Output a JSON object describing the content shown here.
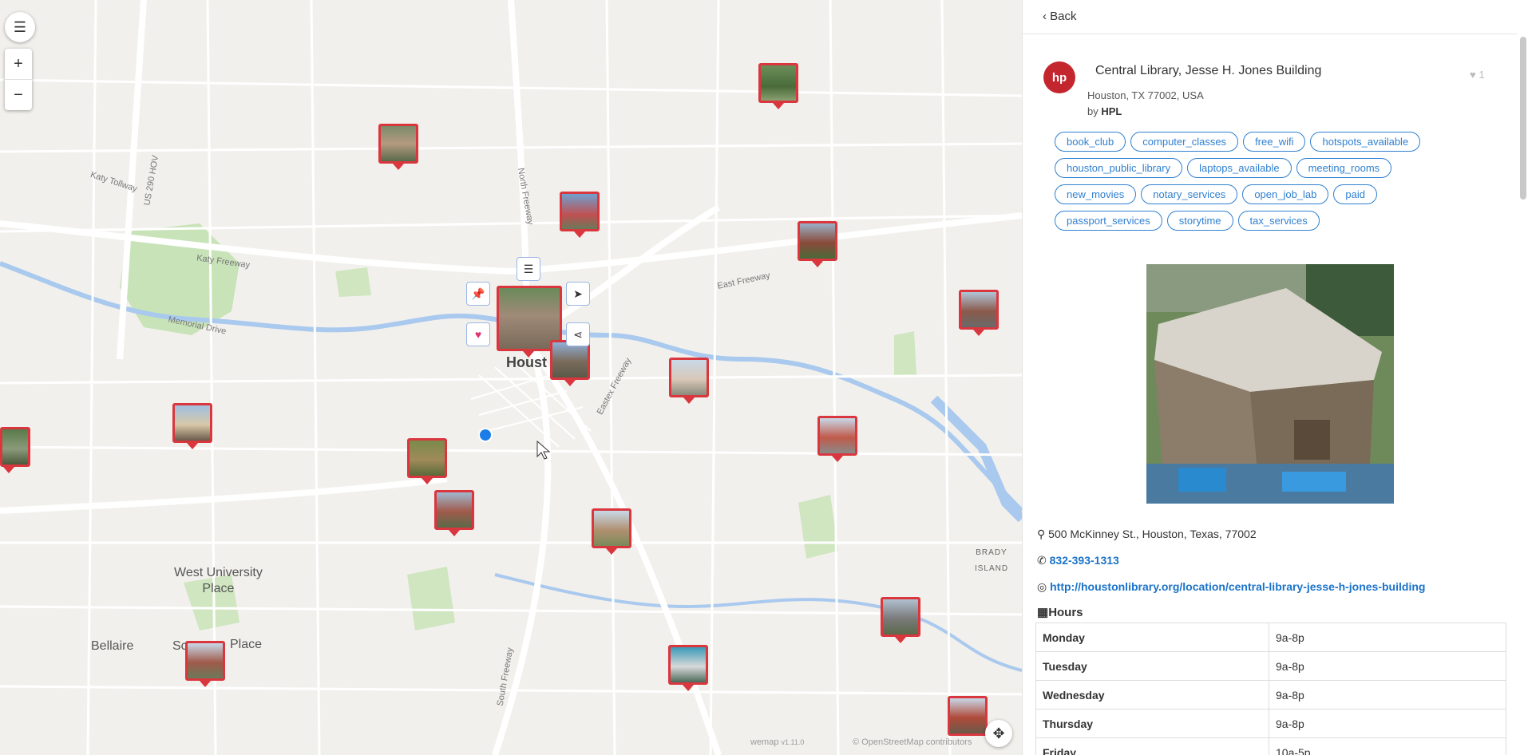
{
  "map": {
    "labels": {
      "city": "Houst",
      "west_university": "West University\nPlace",
      "bellaire": "Bellaire",
      "southside": "Sc",
      "place": "Place",
      "brady_island": "BRADY ISLAND"
    },
    "roads": {
      "katy_tollway": "Katy Tollway",
      "katy_freeway": "Katy Freeway",
      "memorial_drive": "Memorial Drive",
      "north_freeway": "North Freeway",
      "east_freeway": "East Freeway",
      "eastex_freeway": "Eastex Freeway",
      "south_freeway": "South Freeway",
      "us290": "US 290 HOV"
    },
    "controls": {
      "menu_icon": "☰",
      "zoom_in": "+",
      "zoom_out": "−"
    },
    "attribution": {
      "wemap": "wemap",
      "wemap_version": "v1.11.0",
      "osm": "© OpenStreetMap contributors"
    }
  },
  "panel": {
    "back_label": "Back",
    "logo_text": "hp",
    "title": "Central Library, Jesse H. Jones Building",
    "location": "Houston, TX 77002, USA",
    "by_prefix": "by",
    "author": "HPL",
    "likes": "1",
    "tags": [
      "book_club",
      "computer_classes",
      "free_wifi",
      "hotspots_available",
      "houston_public_library",
      "laptops_available",
      "meeting_rooms",
      "new_movies",
      "notary_services",
      "open_job_lab",
      "paid",
      "passport_services",
      "storytime",
      "tax_services"
    ],
    "address": "500 McKinney St., Houston, Texas, 77002",
    "phone": "832-393-1313",
    "website": "http://houstonlibrary.org/location/central-library-jesse-h-jones-building",
    "hours_title": "Hours",
    "hours": [
      {
        "day": "Monday",
        "time": "9a-8p"
      },
      {
        "day": "Tuesday",
        "time": "9a-8p"
      },
      {
        "day": "Wednesday",
        "time": "9a-8p"
      },
      {
        "day": "Thursday",
        "time": "9a-8p"
      },
      {
        "day": "Friday",
        "time": "10a-5p"
      }
    ]
  },
  "colors": {
    "pin_border": "#d9363e",
    "tag_blue": "#2f80d0",
    "water": "#a9c9ee",
    "park": "#c8e3b8",
    "location_dot": "#1a7de8"
  }
}
